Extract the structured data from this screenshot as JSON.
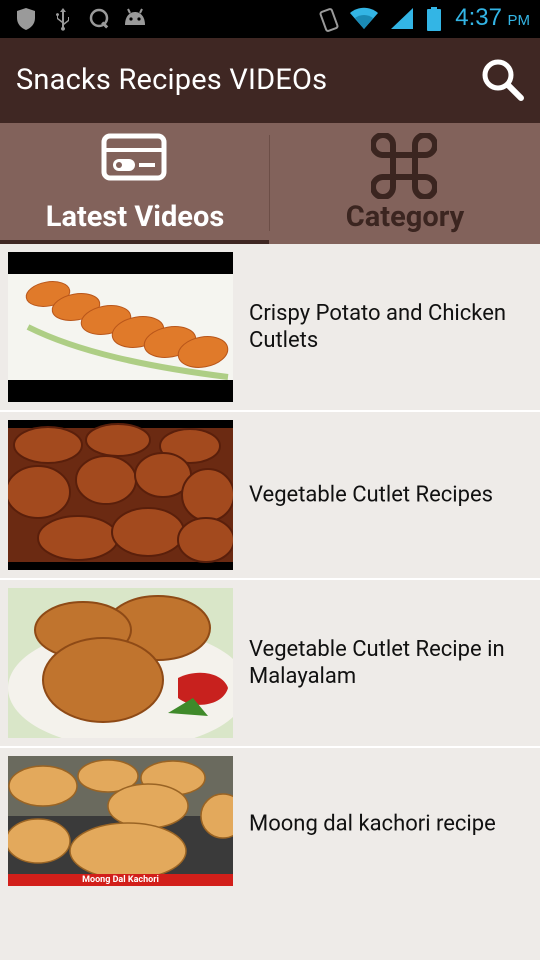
{
  "status_bar": {
    "time": "4:37",
    "ampm": "PM"
  },
  "app_bar": {
    "title": "Snacks Recipes VIDEOs",
    "search_icon": "search-icon"
  },
  "tabs": [
    {
      "label": "Latest Videos",
      "icon": "video-card-icon",
      "selected": true
    },
    {
      "label": "Category",
      "icon": "command-icon",
      "selected": false
    }
  ],
  "videos": [
    {
      "title": "Crispy Potato and Chicken Cutlets"
    },
    {
      "title": "Vegetable Cutlet Recipes"
    },
    {
      "title": "Vegetable Cutlet Recipe in Malayalam"
    },
    {
      "title": "Moong dal kachori recipe",
      "thumb_caption": "Moong Dal Kachori"
    }
  ],
  "colors": {
    "action_bar": "#3f2723",
    "tab_bar": "#82625b",
    "list_bg": "#eeebe8",
    "status_accent": "#33b5e5"
  }
}
